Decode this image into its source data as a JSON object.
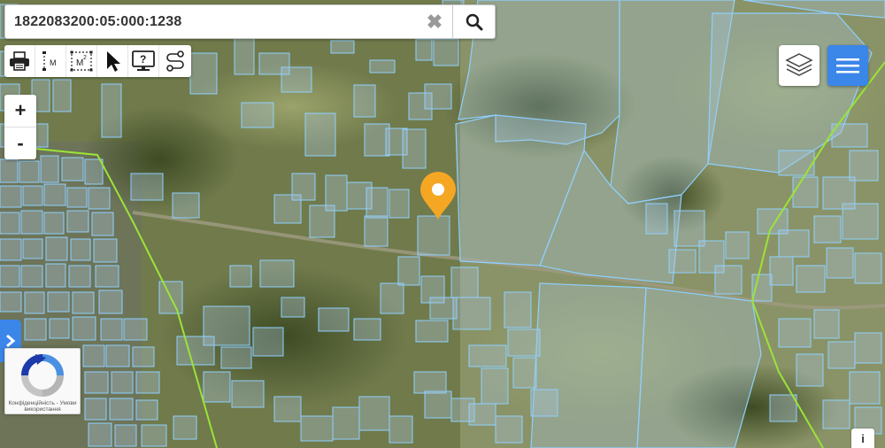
{
  "search": {
    "query": "1822083200:05:000:1238",
    "clear_icon": "close-icon",
    "submit_icon": "search-icon"
  },
  "toolbar": {
    "tools": [
      "print-icon",
      "measure-distance-icon",
      "measure-area-icon",
      "pointer-icon",
      "identify-icon",
      "route-icon"
    ],
    "measure_distance_label": "M",
    "measure_area_label": "M",
    "measure_area_sup": "2"
  },
  "zoom": {
    "in_label": "+",
    "out_label": "-"
  },
  "controls": {
    "layers_icon": "layers-icon",
    "menu_icon": "hamburger-menu-icon",
    "side_panel_icon": "chevron-right-icon",
    "info_label": "i"
  },
  "recaptcha": {
    "text": "Конфіденційність - Умови використання"
  },
  "map": {
    "base_layer": "satellite imagery",
    "parcel_color": "#8fd0ff",
    "boundary_color": "#9be33a",
    "marker_color": "#f5a623"
  }
}
